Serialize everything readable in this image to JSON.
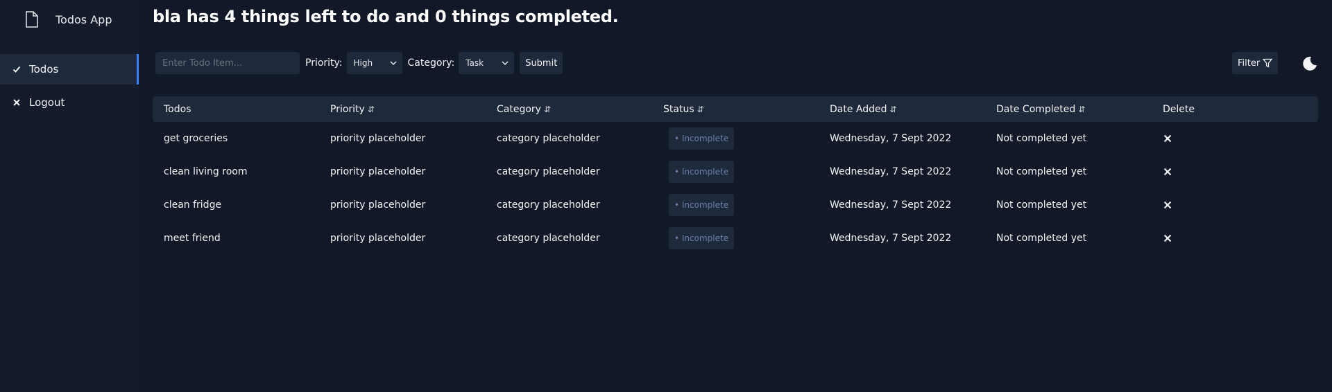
{
  "app": {
    "title": "Todos App"
  },
  "sidebar": {
    "items": [
      {
        "label": "Todos",
        "icon": "check-icon",
        "active": true
      },
      {
        "label": "Logout",
        "icon": "close-icon",
        "active": false
      }
    ]
  },
  "headline": "bla has 4 things left to do and 0 things completed.",
  "form": {
    "input_placeholder": "Enter Todo Item...",
    "input_value": "",
    "priority_label": "Priority:",
    "priority_value": "High",
    "category_label": "Category:",
    "category_value": "Task",
    "submit_label": "Submit"
  },
  "toolbar": {
    "filter_label": "Filter",
    "theme_icon": "moon-icon"
  },
  "table": {
    "headers": [
      "Todos",
      "Priority",
      "Category",
      "Status",
      "Date Added",
      "Date Completed",
      "Delete"
    ],
    "sort_glyph": "⇵",
    "rows": [
      {
        "todo": "get groceries",
        "priority": "priority placeholder",
        "category": "category placeholder",
        "status": "• Incomplete",
        "date_added": "Wednesday, 7 Sept 2022",
        "date_completed": "Not completed yet"
      },
      {
        "todo": "clean living room",
        "priority": "priority placeholder",
        "category": "category placeholder",
        "status": "• Incomplete",
        "date_added": "Wednesday, 7 Sept 2022",
        "date_completed": "Not completed yet"
      },
      {
        "todo": "clean fridge",
        "priority": "priority placeholder",
        "category": "category placeholder",
        "status": "• Incomplete",
        "date_added": "Wednesday, 7 Sept 2022",
        "date_completed": "Not completed yet"
      },
      {
        "todo": "meet friend",
        "priority": "priority placeholder",
        "category": "category placeholder",
        "status": "• Incomplete",
        "date_added": "Wednesday, 7 Sept 2022",
        "date_completed": "Not completed yet"
      }
    ]
  },
  "colors": {
    "background": "#111827",
    "sidebar": "#141c2c",
    "panel": "#1e293b",
    "accent": "#3b82f6",
    "badge_text": "#6b7fa8"
  }
}
